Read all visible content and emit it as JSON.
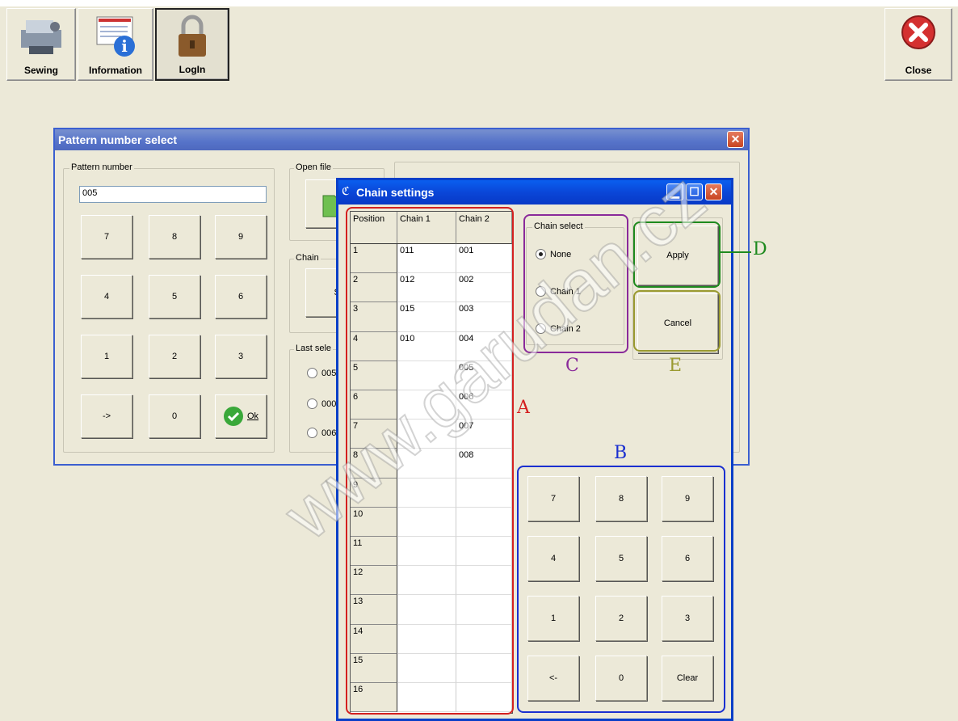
{
  "toolbar": {
    "sewing": "Sewing",
    "information": "Information",
    "login": "LogIn",
    "close": "Close"
  },
  "pattern_window": {
    "title": "Pattern number select",
    "pattern_group": "Pattern number",
    "pattern_value": "005",
    "keypad": [
      "7",
      "8",
      "9",
      "4",
      "5",
      "6",
      "1",
      "2",
      "3",
      "->",
      "0"
    ],
    "ok_label": "Ok",
    "open_file_group": "Open file",
    "chain_group": "Chain",
    "chain_button": "Se",
    "last_group": "Last sele",
    "last_items": [
      "005",
      "000",
      "006"
    ]
  },
  "chain_window": {
    "title": "Chain settings",
    "columns": [
      "Position",
      "Chain 1",
      "Chain 2"
    ],
    "rows": [
      {
        "pos": "1",
        "c1": "011",
        "c2": "001"
      },
      {
        "pos": "2",
        "c1": "012",
        "c2": "002"
      },
      {
        "pos": "3",
        "c1": "015",
        "c2": "003"
      },
      {
        "pos": "4",
        "c1": "010",
        "c2": "004"
      },
      {
        "pos": "5",
        "c1": "",
        "c2": "005"
      },
      {
        "pos": "6",
        "c1": "",
        "c2": "006"
      },
      {
        "pos": "7",
        "c1": "",
        "c2": "007"
      },
      {
        "pos": "8",
        "c1": "",
        "c2": "008"
      },
      {
        "pos": "9",
        "c1": "",
        "c2": ""
      },
      {
        "pos": "10",
        "c1": "",
        "c2": ""
      },
      {
        "pos": "11",
        "c1": "",
        "c2": ""
      },
      {
        "pos": "12",
        "c1": "",
        "c2": ""
      },
      {
        "pos": "13",
        "c1": "",
        "c2": ""
      },
      {
        "pos": "14",
        "c1": "",
        "c2": ""
      },
      {
        "pos": "15",
        "c1": "",
        "c2": ""
      },
      {
        "pos": "16",
        "c1": "",
        "c2": ""
      }
    ],
    "chain_select_group": "Chain select",
    "chain_select_options": [
      "None",
      "Chain 1",
      "Chain 2"
    ],
    "chain_select_selected": "None",
    "apply": "Apply",
    "cancel": "Cancel",
    "keypad": [
      "7",
      "8",
      "9",
      "4",
      "5",
      "6",
      "1",
      "2",
      "3",
      "<-",
      "0",
      "Clear"
    ]
  },
  "annotations": {
    "A": "A",
    "B": "B",
    "C": "C",
    "D": "D",
    "E": "E",
    "colors": {
      "A": "#D42020",
      "B": "#1A2FD0",
      "C": "#8A2A9A",
      "D": "#1E8A1E",
      "E": "#9A9A30"
    }
  },
  "watermark": "www.garudan.cz"
}
